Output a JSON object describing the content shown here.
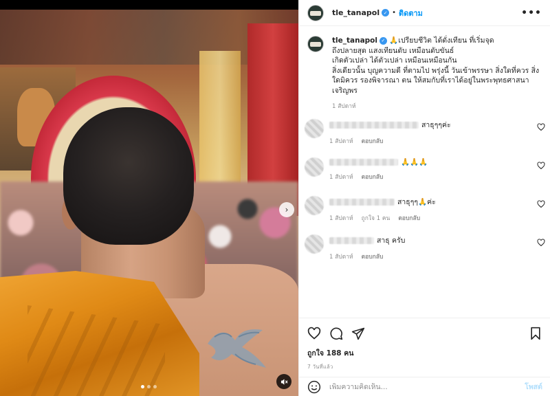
{
  "post": {
    "username": "tle_tanapol",
    "separator": "•",
    "follow_label": "ติดตาม",
    "more_label": "•••",
    "caption_text": "🙏เปรียบชีวิต ได้ดั่งเทียน ที่เริ่มจุด\nถึงปลายสุด แสงเทียนดับ เหมือนดับขันธ์\nเกิดตัวเปล่า ได้ตัวเปล่า เหมือนเหมือนกัน\nสิ่งเดียวนั้น บุญความดี ที่ตามไป พรุ่งนี้ วันเข้าพรรษา สิ่งใดที่ควร สิ่งใดมิควร รองพิจารณา ตน ให้สมกับที่เราได้อยู่ในพระพุทธศาสนา เจริญพร",
    "caption_time": "1 สัปดาห์",
    "likes_text": "ถูกใจ 188 คน",
    "posted_ago": "7 วันที่แล้ว",
    "comment_placeholder": "เพิ่มความคิดเห็น...",
    "post_button": "โพสต์"
  },
  "comments": [
    {
      "text": "สาธุๆๆค่ะ",
      "time": "1 สัปดาห์",
      "likes": "",
      "reply": "ตอบกลับ"
    },
    {
      "text": "🙏🙏🙏",
      "time": "1 สัปดาห์",
      "likes": "",
      "reply": "ตอบกลับ"
    },
    {
      "text": "สาธุๆๆ🙏ค่ะ",
      "time": "1 สัปดาห์",
      "likes": "ถูกใจ 1 คน",
      "reply": "ตอบกลับ"
    },
    {
      "text": "สาธุ ครับ",
      "time": "1 สัปดาห์",
      "likes": "",
      "reply": "ตอบกลับ"
    }
  ],
  "media": {
    "next_icon": "chevron-right-icon",
    "next_glyph": "›",
    "sound_icon": "speaker-muted-icon",
    "carousel_count": 3,
    "carousel_active": 1
  },
  "colors": {
    "accent": "#0095f6",
    "verified": "#3897f0",
    "robe": "#e08a16",
    "text_secondary": "#8e8e8e"
  }
}
